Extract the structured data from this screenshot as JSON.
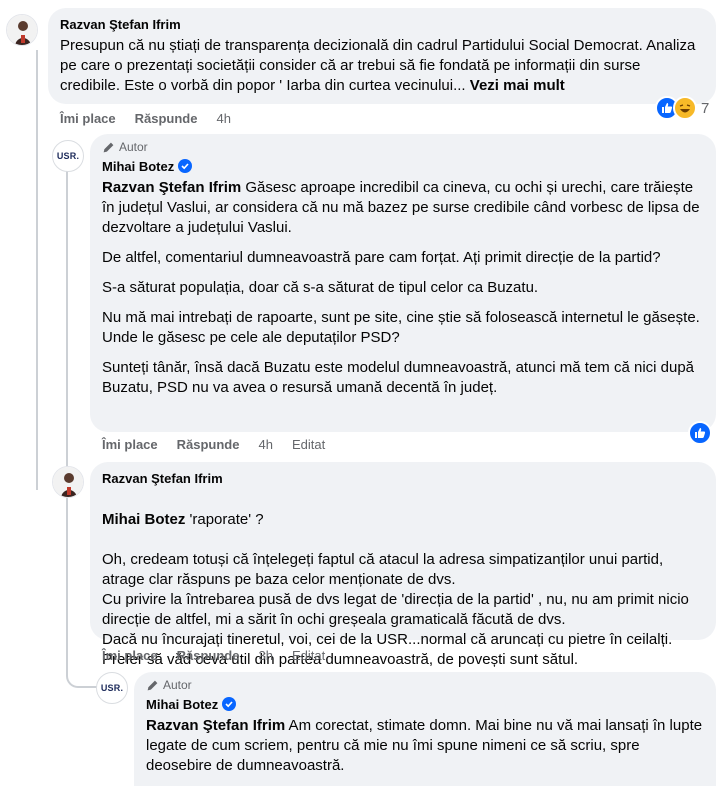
{
  "colors": {
    "bubble": "#f0f2f5",
    "like": "#0866ff",
    "verified": "#0866ff",
    "meta": "#65676b"
  },
  "comment1": {
    "author": "Razvan Ştefan Ifrim",
    "text": "Presupun că nu știați de transparența decizională din cadrul Partidului Social Democrat. Analiza pe care o prezentați societății consider că ar trebui să fie fondată pe informații din surse credibile. Este o vorbă din popor ' Iarba din curtea vecinului...",
    "see_more": "Vezi mai mult",
    "reaction_count": "7",
    "actions": {
      "like": "Îmi place",
      "reply": "Răspunde",
      "time": "4h"
    },
    "reaction_icons": [
      "like-icon",
      "haha-icon"
    ]
  },
  "comment2": {
    "author_tag": "Autor",
    "author": "Mihai Botez",
    "avatar_text": "USR.",
    "mention": "Razvan Ştefan Ifrim",
    "p1": " Găsesc aproape incredibil ca cineva, cu ochi și urechi, care trăiește în județul Vaslui, ar considera că nu mă bazez pe surse credibile când vorbesc de lipsa de dezvoltare a județului Vaslui.",
    "p2": "De altfel, comentariul dumneavoastră pare cam forțat. Ați primit direcție de la partid?",
    "p3": "S-a săturat populația, doar că s-a săturat de tipul celor ca Buzatu.",
    "p4": "Nu mă mai intrebați de rapoarte, sunt pe site, cine știe să folosească internetul le găsește. Unde le găsesc pe cele ale deputaților PSD?",
    "p5": "Sunteți tânăr, însă dacă Buzatu este modelul dumneavoastră, atunci mă tem că nici după Buzatu, PSD nu va avea o resursă umană decentă în județ.",
    "actions": {
      "like": "Îmi place",
      "reply": "Răspunde",
      "time": "4h",
      "edited": "Editat"
    }
  },
  "comment3": {
    "author": "Razvan Ştefan Ifrim",
    "mention": "Mihai Botez",
    "line1": " 'raporate' ?",
    "text": "Oh, credeam totuși că înțelegeți faptul că atacul la adresa simpatizanților unui partid, atrage clar răspuns pe baza celor menționate de dvs.\nCu privire la întrebarea pusă de dvs legat de 'direcția de la partid' , nu, nu am primit nicio direcție de altfel, mi a sărit în ochi greșeala gramaticală făcută de dvs.\nDacă nu încurajați tineretul, voi, cei de la USR...normal că aruncați cu pietre în ceilalți.\nPrefer să văd ceva util din partea dumneavoastră, de povești sunt sătul.",
    "actions": {
      "like": "Îmi place",
      "reply": "Răspunde",
      "time": "3h",
      "edited": "Editat"
    }
  },
  "comment4": {
    "author_tag": "Autor",
    "author": "Mihai Botez",
    "avatar_text": "USR.",
    "mention": "Razvan Ştefan Ifrim",
    "text": " Am corectat, stimate domn. Mai bine nu vă mai lansați în lupte legate de cum scriem, pentru că mie nu îmi spune nimeni ce să scriu, spre deosebire de dumneavoastră."
  }
}
